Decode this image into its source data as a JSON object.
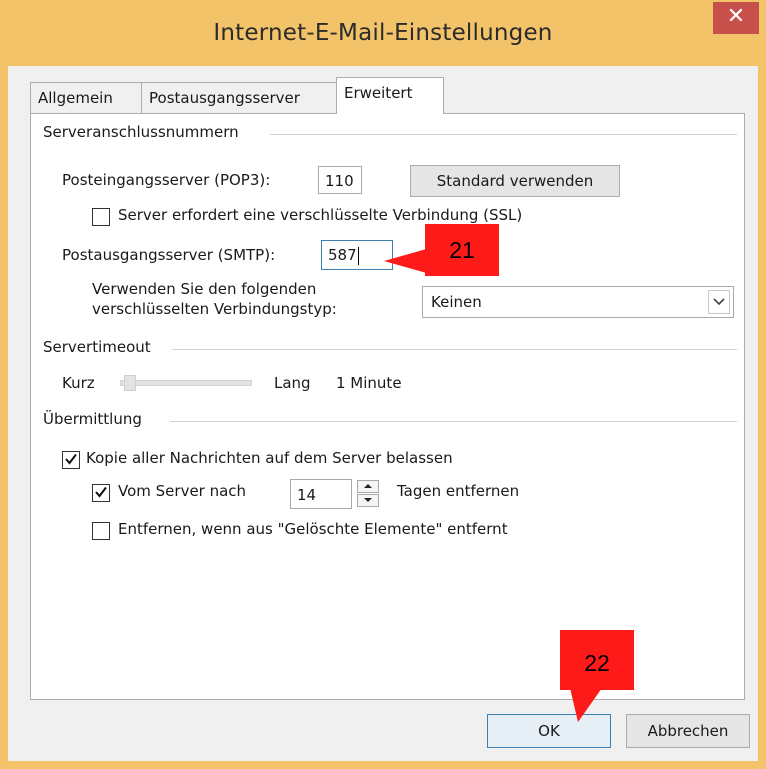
{
  "window": {
    "title": "Internet-E-Mail-Einstellungen",
    "close_label": "✕"
  },
  "tabs": [
    {
      "label": "Allgemein",
      "active": false
    },
    {
      "label": "Postausgangsserver",
      "active": false
    },
    {
      "label": "Erweitert",
      "active": true
    }
  ],
  "ports": {
    "group_title": "Serveranschlussnummern",
    "pop3_label": "Posteingangsserver (POP3):",
    "pop3_value": "110",
    "default_button": "Standard verwenden",
    "ssl_label": "Server erfordert eine verschlüsselte Verbindung (SSL)",
    "ssl_checked": false,
    "smtp_label": "Postausgangsserver (SMTP):",
    "smtp_value": "587",
    "encryption_label_line1": "Verwenden Sie den folgenden",
    "encryption_label_line2": "verschlüsselten Verbindungstyp:",
    "encryption_value": "Keinen"
  },
  "timeout": {
    "group_title": "Servertimeout",
    "short_label": "Kurz",
    "long_label": "Lang",
    "value_label": "1 Minute",
    "slider_fraction": 0.0
  },
  "delivery": {
    "group_title": "Übermittlung",
    "keep_copy_label": "Kopie aller Nachrichten auf dem Server belassen",
    "keep_copy_checked": true,
    "remove_after_label": "Vom Server nach",
    "remove_after_checked": true,
    "remove_after_days": "14",
    "remove_after_suffix": "Tagen entfernen",
    "remove_deleted_label": "Entfernen, wenn aus \"Gelöschte Elemente\" entfernt",
    "remove_deleted_checked": false
  },
  "footer": {
    "ok_label": "OK",
    "cancel_label": "Abbrechen"
  },
  "annotations": {
    "badge_21": "21",
    "badge_22": "22",
    "badge_color": "#ff1a1a"
  },
  "icons": {
    "checkmark": "check-icon",
    "dropdown": "chevron-down-icon",
    "close": "close-icon"
  }
}
